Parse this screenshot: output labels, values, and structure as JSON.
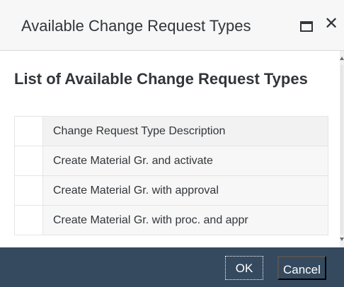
{
  "dialog": {
    "title": "Available Change Request Types",
    "maximize_icon": "maximize-icon",
    "close_icon": "close-icon",
    "close_glyph": "✕"
  },
  "content": {
    "list_title": "List of Available Change Request Types",
    "table": {
      "column_header": "Change Request Type Description",
      "rows": [
        {
          "description": "Create Material Gr. and activate"
        },
        {
          "description": "Create Material Gr. with approval"
        },
        {
          "description": "Create Material Gr. with proc. and appr"
        }
      ]
    }
  },
  "footer": {
    "ok_label": "OK",
    "cancel_label": "Cancel"
  },
  "colors": {
    "footer_bg": "#354a5f",
    "header_bg": "#f7f7f7",
    "text": "#32363a"
  }
}
